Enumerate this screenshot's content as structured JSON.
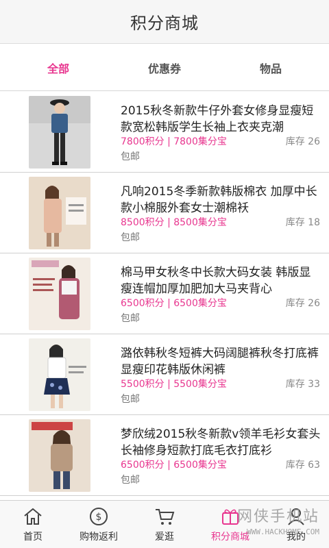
{
  "header": {
    "title": "积分商城"
  },
  "tabs": [
    {
      "label": "全部",
      "active": true
    },
    {
      "label": "优惠券",
      "active": false
    },
    {
      "label": "物品",
      "active": false
    }
  ],
  "products": [
    {
      "name": "2015秋冬新款牛仔外套女修身显瘦短款宽松韩版学生长袖上衣夹克潮",
      "price": "7800积分 | 7800集分宝",
      "stock": "库存 26",
      "shipping": "包邮"
    },
    {
      "name": "凡响2015冬季新款韩版棉衣 加厚中长款小棉服外套女士潮棉袄",
      "price": "8500积分 | 8500集分宝",
      "stock": "库存 18",
      "shipping": "包邮"
    },
    {
      "name": "棉马甲女秋冬中长款大码女装 韩版显瘦连帽加厚加肥加大马夹背心",
      "price": "6500积分 | 6500集分宝",
      "stock": "库存 26",
      "shipping": "包邮"
    },
    {
      "name": "潞依韩秋冬短裤大码阔腿裤秋冬打底裤显瘦印花韩版休闲裤",
      "price": "5500积分 | 5500集分宝",
      "stock": "库存 33",
      "shipping": "包邮"
    },
    {
      "name": "梦欣绒2015秋冬新款v领羊毛衫女套头长袖修身短款打底毛衣打底衫",
      "price": "6500积分 | 6500集分宝",
      "stock": "库存 63",
      "shipping": "包邮"
    }
  ],
  "tabbar": [
    {
      "label": "首页",
      "icon": "home-icon",
      "active": false
    },
    {
      "label": "购物返利",
      "icon": "dollar-coin-icon",
      "active": false
    },
    {
      "label": "爱逛",
      "icon": "cart-icon",
      "active": false
    },
    {
      "label": "积分商城",
      "icon": "gift-box-icon",
      "active": true
    },
    {
      "label": "我的",
      "icon": "user-icon",
      "active": false
    }
  ],
  "watermark": {
    "brand": "网侠手机站",
    "url": "WWW.HACKHOME.COM"
  },
  "colors": {
    "accent": "#e8368f",
    "header_bg": "#f6f6f6",
    "divider": "#cfcfcf"
  }
}
